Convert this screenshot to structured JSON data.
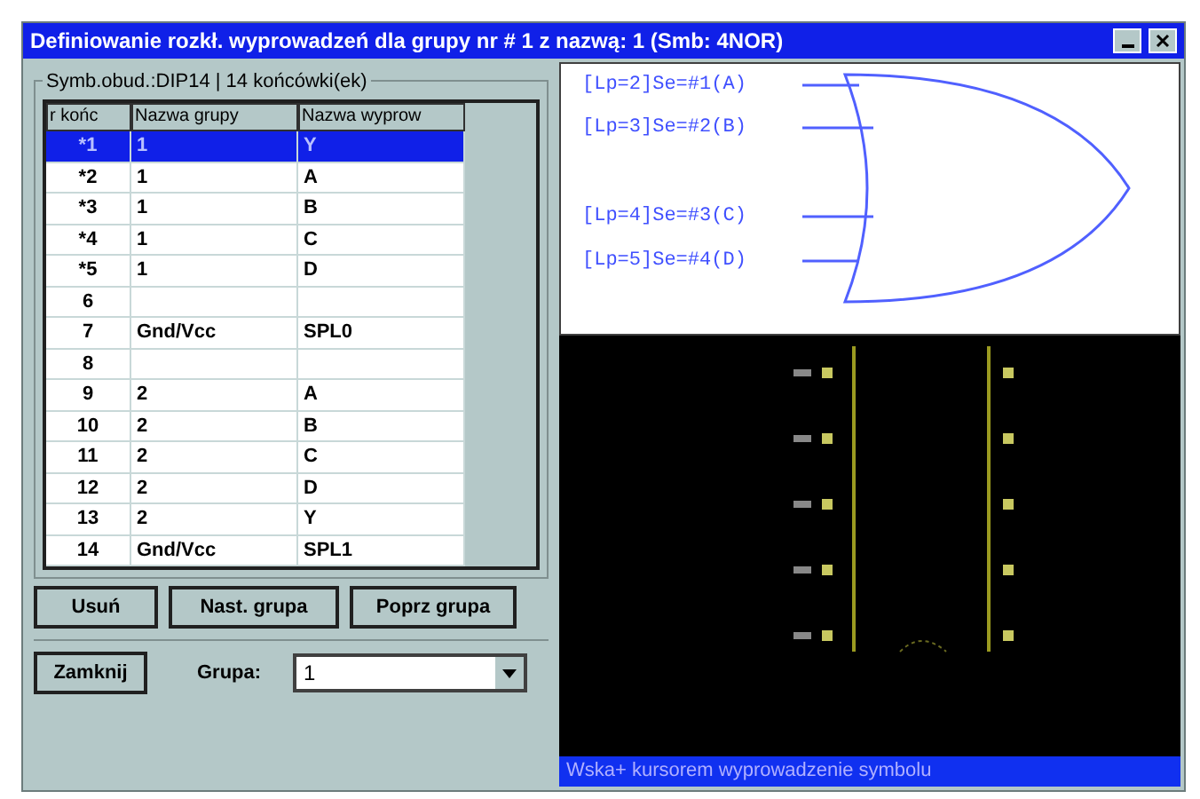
{
  "window": {
    "title": "Definiowanie rozkł. wyprowadzeń dla grupy nr # 1 z nazwą: 1 (Smb: 4NOR)"
  },
  "group_box": {
    "label": "Symb.obud.:DIP14 | 14 końcówki(ek)"
  },
  "table": {
    "columns": [
      "r końc",
      "Nazwa grupy",
      "Nazwa wyprow"
    ],
    "rows": [
      {
        "pin": "*1",
        "group": "1",
        "name": "Y",
        "selected": true
      },
      {
        "pin": "*2",
        "group": "1",
        "name": "A",
        "selected": false
      },
      {
        "pin": "*3",
        "group": "1",
        "name": "B",
        "selected": false
      },
      {
        "pin": "*4",
        "group": "1",
        "name": "C",
        "selected": false
      },
      {
        "pin": "*5",
        "group": "1",
        "name": "D",
        "selected": false
      },
      {
        "pin": "6",
        "group": "",
        "name": "",
        "selected": false
      },
      {
        "pin": "7",
        "group": "Gnd/Vcc",
        "name": "SPL0",
        "selected": false
      },
      {
        "pin": "8",
        "group": "",
        "name": "",
        "selected": false
      },
      {
        "pin": "9",
        "group": "2",
        "name": "A",
        "selected": false
      },
      {
        "pin": "10",
        "group": "2",
        "name": "B",
        "selected": false
      },
      {
        "pin": "11",
        "group": "2",
        "name": "C",
        "selected": false
      },
      {
        "pin": "12",
        "group": "2",
        "name": "D",
        "selected": false
      },
      {
        "pin": "13",
        "group": "2",
        "name": "Y",
        "selected": false
      },
      {
        "pin": "14",
        "group": "Gnd/Vcc",
        "name": "SPL1",
        "selected": false
      }
    ]
  },
  "buttons": [
    "Usuń",
    "Nast. grupa",
    "Poprz grupa"
  ],
  "close_button": "Zamknij",
  "group_field": {
    "label": "Grupa:",
    "value": "1"
  },
  "gate": {
    "inputs": [
      "[Lp=2]Se=#1(A)",
      "[Lp=3]Se=#2(B)",
      "[Lp=4]Se=#3(C)",
      "[Lp=5]Se=#4(D)"
    ]
  },
  "status_bar": "Wska+ kursorem wyprowadzenie symbolu"
}
